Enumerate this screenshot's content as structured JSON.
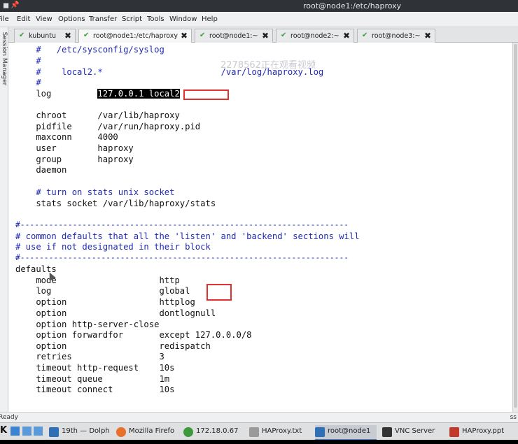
{
  "window": {
    "title": "root@node1:/etc/haproxy"
  },
  "menu": [
    "File",
    "Edit",
    "View",
    "Options",
    "Transfer",
    "Script",
    "Tools",
    "Window",
    "Help"
  ],
  "side_label": "Session Manager",
  "tabs": [
    {
      "label": "kubuntu"
    },
    {
      "label": "root@node1:/etc/haproxy"
    },
    {
      "label": "root@node1:~"
    },
    {
      "label": "root@node2:~"
    },
    {
      "label": "root@node3:~"
    }
  ],
  "watermark": "2278562正在观看视频",
  "terminal_lines": [
    "    #   /etc/sysconfig/syslog",
    "    #",
    "    #    local2.*                       /var/log/haproxy.log",
    "    #",
    "    log         ",
    "",
    "    chroot      /var/lib/haproxy",
    "    pidfile     /var/run/haproxy.pid",
    "    maxconn     4000",
    "    user        haproxy",
    "    group       haproxy",
    "    daemon",
    "",
    "    # turn on stats unix socket",
    "    stats socket /var/lib/haproxy/stats",
    "",
    "#---------------------------------------------------------------------",
    "# common defaults that all the 'listen' and 'backend' sections will",
    "# use if not designated in their block",
    "#---------------------------------------------------------------------",
    "defaults",
    "    mode                    http",
    "    log                     global",
    "    option                  httplog",
    "    option                  dontlognull",
    "    option http-server-close",
    "    option forwardfor       except 127.0.0.0/8",
    "    option                  redispatch",
    "    retries                 3",
    "    timeout http-request    10s",
    "    timeout queue           1m",
    "    timeout connect         10s"
  ],
  "highlight": "127.0.0.1 local2",
  "status": {
    "left": "Ready",
    "right": "ss"
  },
  "taskbar": [
    {
      "label": "19th — Dolph",
      "color": "#2f6fb5"
    },
    {
      "label": "Mozilla Firefo",
      "color": "#e8702a"
    },
    {
      "label": "172.18.0.67",
      "color": "#3c9a3c"
    },
    {
      "label": "HAProxy.txt",
      "color": "#9a9a9a"
    },
    {
      "label": "root@node1",
      "color": "#2f6fb5"
    },
    {
      "label": "VNC Server",
      "color": "#333"
    },
    {
      "label": "HAProxy.ppt",
      "color": "#c0392b"
    }
  ]
}
